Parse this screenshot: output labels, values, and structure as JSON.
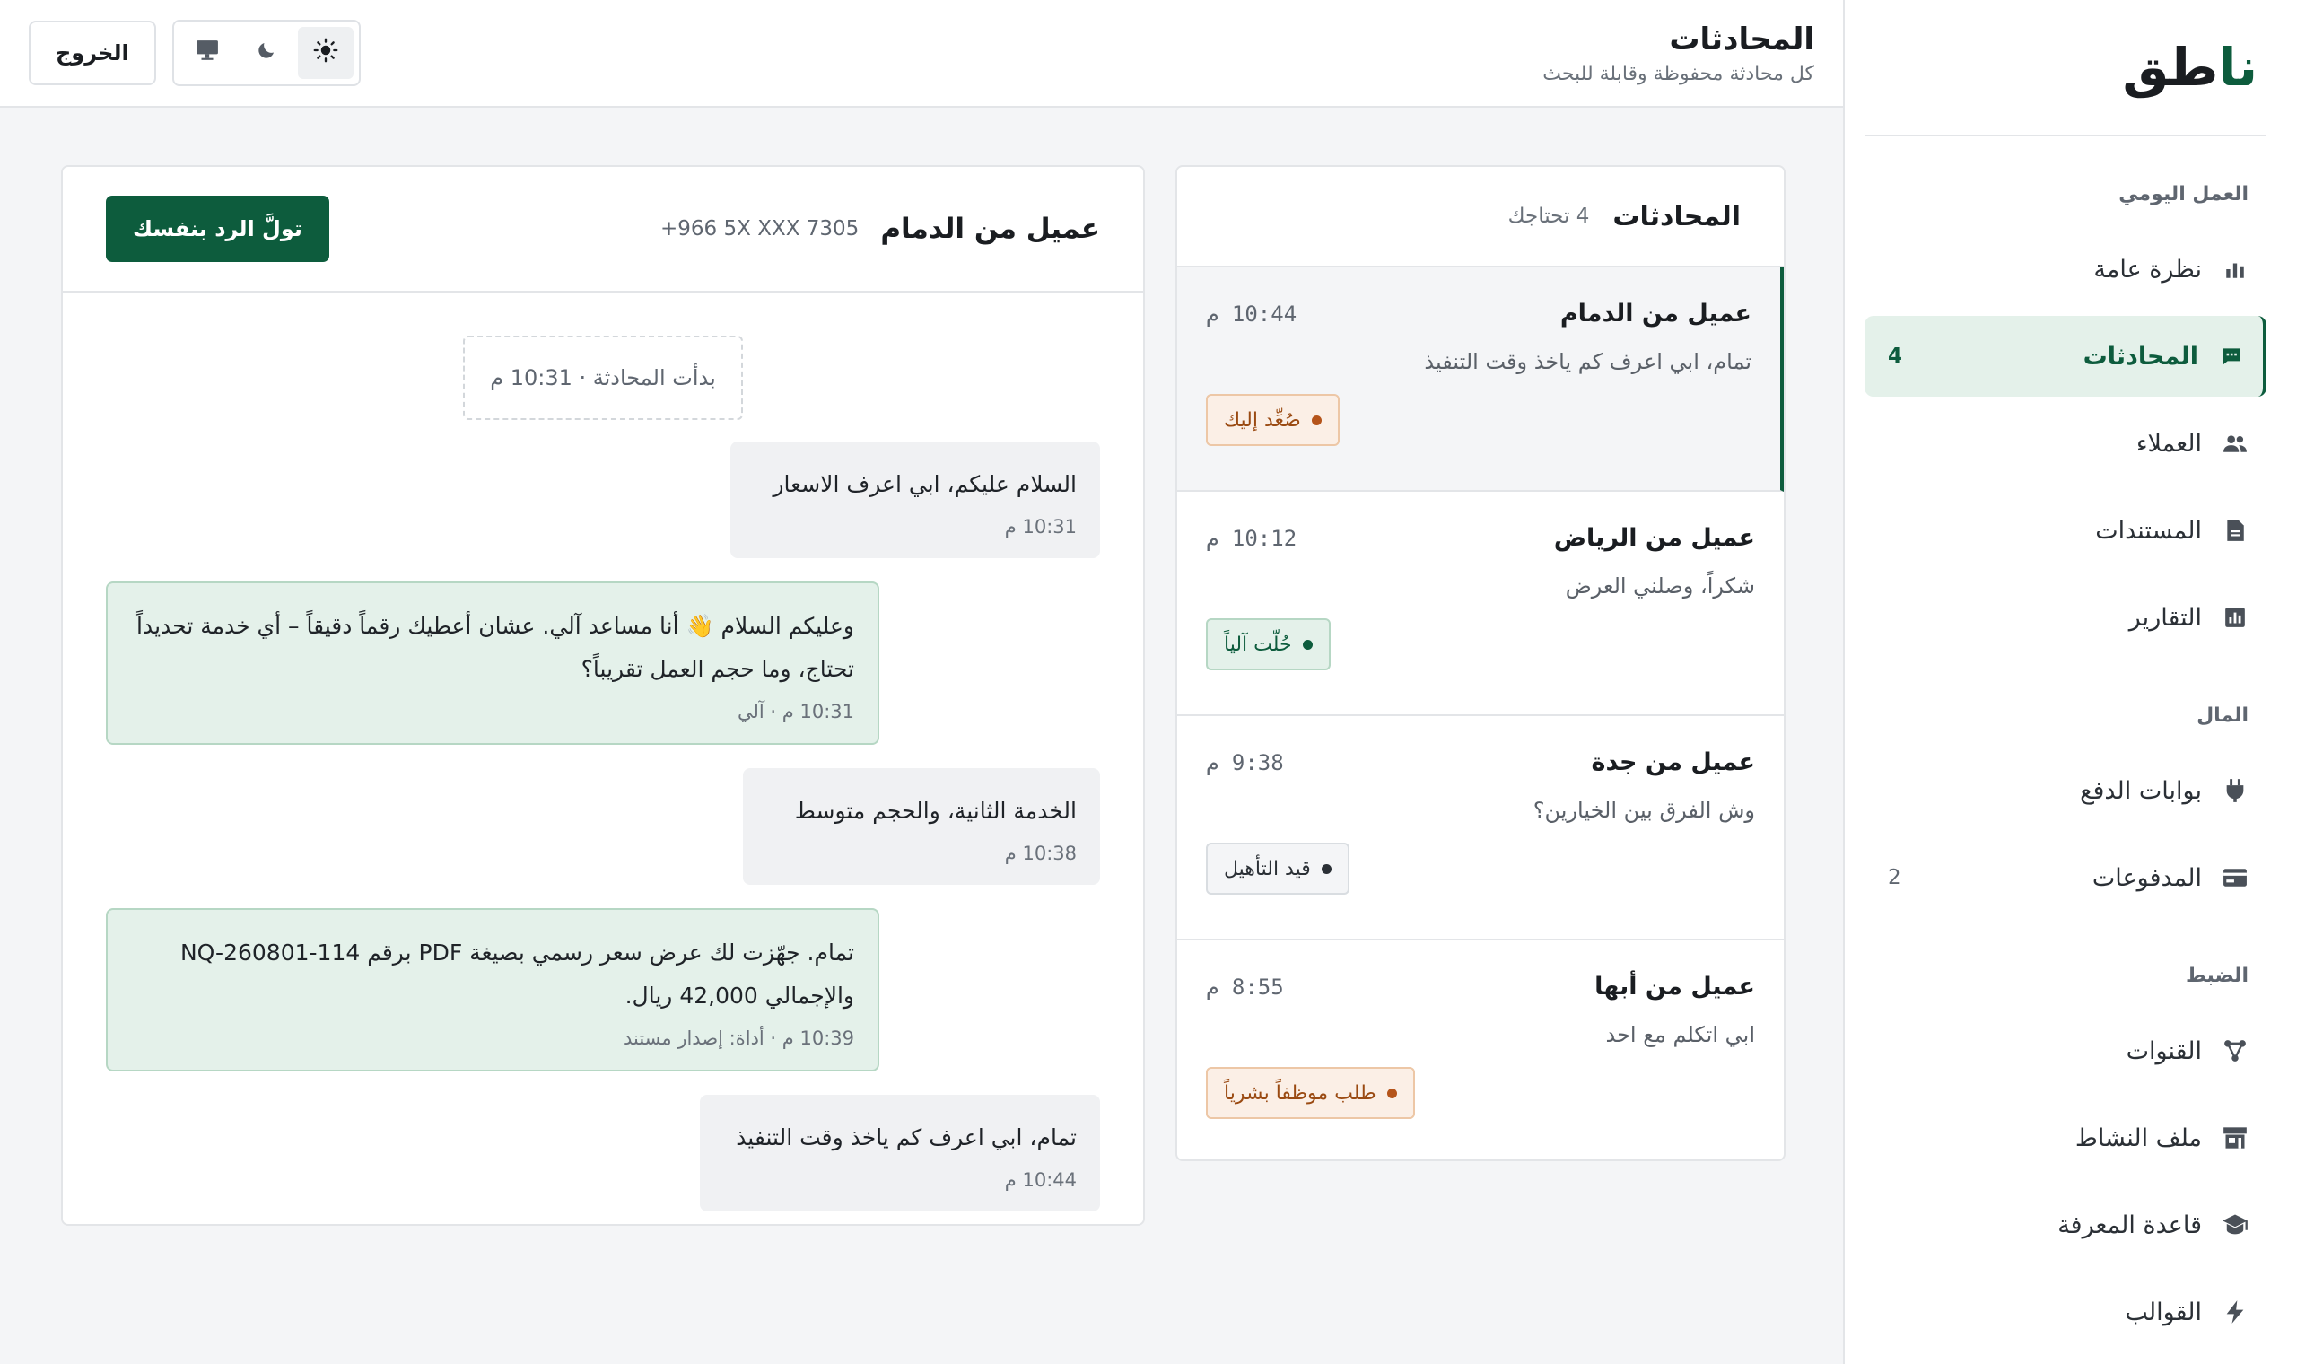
{
  "brand": {
    "part1": "نا",
    "part2": "طق"
  },
  "sidebar": {
    "groups": [
      {
        "title": "العمل اليومي",
        "items": [
          {
            "label": "نظرة عامة",
            "icon": "bar-chart-icon",
            "count": ""
          },
          {
            "label": "المحادثات",
            "icon": "chat-icon",
            "count": "4",
            "active": true
          },
          {
            "label": "العملاء",
            "icon": "users-icon",
            "count": ""
          },
          {
            "label": "المستندات",
            "icon": "document-icon",
            "count": ""
          },
          {
            "label": "التقارير",
            "icon": "report-icon",
            "count": ""
          }
        ]
      },
      {
        "title": "المال",
        "items": [
          {
            "label": "بوابات الدفع",
            "icon": "plug-icon",
            "count": ""
          },
          {
            "label": "المدفوعات",
            "icon": "card-icon",
            "count": "2"
          }
        ]
      },
      {
        "title": "الضبط",
        "items": [
          {
            "label": "القنوات",
            "icon": "channels-icon",
            "count": ""
          },
          {
            "label": "ملف النشاط",
            "icon": "store-icon",
            "count": ""
          },
          {
            "label": "قاعدة المعرفة",
            "icon": "graduation-cap-icon",
            "count": ""
          },
          {
            "label": "القوالب",
            "icon": "lightning-icon",
            "count": ""
          }
        ]
      }
    ]
  },
  "topbar": {
    "title": "المحادثات",
    "subtitle": "كل محادثة محفوظة وقابلة للبحث",
    "theme_options": [
      "light-mode-icon",
      "dark-mode-icon",
      "system-mode-icon"
    ],
    "theme_selected": "light",
    "logout_label": "الخروج"
  },
  "conversations": {
    "title": "المحادثات",
    "subtitle": "4 تحتاجك",
    "items": [
      {
        "name": "عميل من الدمام",
        "time": "10:44 م",
        "snippet": "تمام، ابي اعرف كم ياخذ وقت التنفيذ",
        "badge": "صُعِّد إليك",
        "badge_type": "escalated",
        "active": true
      },
      {
        "name": "عميل من الرياض",
        "time": "10:12 م",
        "snippet": "شكراً، وصلني العرض",
        "badge": "حُلّت آلياً",
        "badge_type": "auto"
      },
      {
        "name": "عميل من جدة",
        "time": "9:38 م",
        "snippet": "وش الفرق بين الخيارين؟",
        "badge": "قيد التأهيل",
        "badge_type": "qual"
      },
      {
        "name": "عميل من أبها",
        "time": "8:55 م",
        "snippet": "ابي اتكلم مع احد",
        "badge": "طلب موظفاً بشرياً",
        "badge_type": "escalated"
      }
    ]
  },
  "chat": {
    "name": "عميل من الدمام",
    "phone": "+966 5X XXX 7305",
    "takeover_label": "تولَّ الرد بنفسك",
    "started_label": "بدأت المحادثة · 10:31 م",
    "messages": [
      {
        "from": "customer",
        "text": "السلام عليكم، ابي اعرف الاسعار",
        "meta": "10:31 م"
      },
      {
        "from": "bot",
        "text": "وعليكم السلام 👋 أنا مساعد آلي. عشان أعطيك رقماً دقيقاً – أي خدمة تحديداً تحتاج، وما حجم العمل تقريباً؟",
        "meta": "10:31 م · آلي"
      },
      {
        "from": "customer",
        "text": "الخدمة الثانية، والحجم متوسط",
        "meta": "10:38 م"
      },
      {
        "from": "bot",
        "text": "تمام. جهّزت لك عرض سعر رسمي بصيغة PDF برقم NQ-260801-114 والإجمالي 42,000 ريال.",
        "meta": "10:39 م · أداة: إصدار مستند"
      },
      {
        "from": "customer",
        "text": "تمام، ابي اعرف كم ياخذ وقت التنفيذ",
        "meta": "10:44 م"
      }
    ]
  },
  "colors": {
    "brand": "#0d5c3d",
    "bot_bubble": "#e4f1ea",
    "escalated": "#b5541a"
  }
}
